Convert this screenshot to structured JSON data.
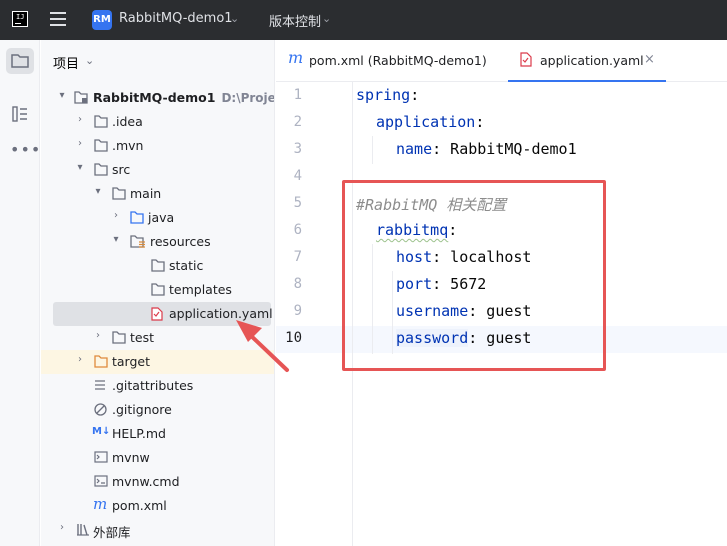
{
  "titlebar": {
    "logo_text": "IJ",
    "project_badge": "RM",
    "project_name": "RabbitMQ-demo1",
    "vcs_label": "版本控制"
  },
  "project_panel": {
    "header": "项目",
    "tree": [
      {
        "label": "RabbitMQ-demo1",
        "path": "D:\\Project\\t",
        "icon": "module-folder-icon",
        "expanded": true
      },
      {
        "label": ".idea",
        "icon": "folder-icon",
        "expanded": false
      },
      {
        "label": ".mvn",
        "icon": "folder-icon",
        "expanded": false
      },
      {
        "label": "src",
        "icon": "folder-icon",
        "expanded": true
      },
      {
        "label": "main",
        "icon": "folder-icon",
        "expanded": true
      },
      {
        "label": "java",
        "icon": "source-folder-icon",
        "expanded": false
      },
      {
        "label": "resources",
        "icon": "resources-folder-icon",
        "expanded": true
      },
      {
        "label": "static",
        "icon": "folder-icon"
      },
      {
        "label": "templates",
        "icon": "folder-icon"
      },
      {
        "label": "application.yaml",
        "icon": "yaml-file-icon",
        "selected": true
      },
      {
        "label": "test",
        "icon": "folder-icon",
        "expanded": false
      },
      {
        "label": "target",
        "icon": "excluded-folder-icon",
        "expanded": false
      },
      {
        "label": ".gitattributes",
        "icon": "text-file-icon"
      },
      {
        "label": ".gitignore",
        "icon": "gitignore-file-icon"
      },
      {
        "label": "HELP.md",
        "icon": "markdown-file-icon"
      },
      {
        "label": "mvnw",
        "icon": "shell-file-icon"
      },
      {
        "label": "mvnw.cmd",
        "icon": "cmd-file-icon"
      },
      {
        "label": "pom.xml",
        "icon": "maven-file-icon"
      },
      {
        "label": "外部库",
        "icon": "library-icon",
        "expanded": false
      }
    ]
  },
  "tabs": [
    {
      "label": "pom.xml (RabbitMQ-demo1)",
      "icon": "maven-file-icon",
      "active": false
    },
    {
      "label": "application.yaml",
      "icon": "yaml-file-icon",
      "active": true,
      "close": "×"
    }
  ],
  "editor": {
    "current_line": 10,
    "lines": [
      {
        "n": "1",
        "key": "spring",
        "sep": ":",
        "value": ""
      },
      {
        "n": "2",
        "key": "application",
        "sep": ":",
        "value": ""
      },
      {
        "n": "3",
        "key": "name",
        "sep": ":",
        "value": " RabbitMQ-demo1"
      },
      {
        "n": "4",
        "key": "",
        "sep": "",
        "value": ""
      },
      {
        "n": "5",
        "comment": "#RabbitMQ 相关配置"
      },
      {
        "n": "6",
        "key": "rabbitmq",
        "sep": ":",
        "value": ""
      },
      {
        "n": "7",
        "key": "host",
        "sep": ":",
        "value": " localhost"
      },
      {
        "n": "8",
        "key": "port",
        "sep": ":",
        "value": " 5672"
      },
      {
        "n": "9",
        "key": "username",
        "sep": ":",
        "value": " guest"
      },
      {
        "n": "10",
        "key": "password",
        "sep": ":",
        "value": " guest"
      }
    ]
  },
  "colors": {
    "accent": "#3574f0",
    "annotation_red": "#e65555",
    "yaml_key": "#0033b3",
    "comment": "#8c8c8c"
  }
}
